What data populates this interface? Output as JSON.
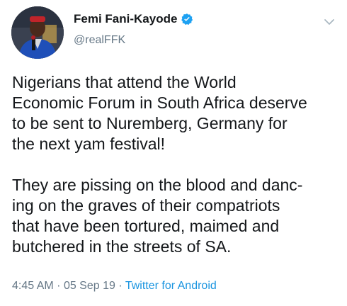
{
  "tweet": {
    "author": {
      "display_name": "Femi Fani-Kayode",
      "handle": "@realFFK",
      "verified_icon": "verified-badge-icon",
      "avatar": "avatar-photo"
    },
    "menu_icon": "chevron-down-icon",
    "paragraphs": [
      "Nigerians that attend the World\nEconomic Forum in South Africa deserve\nto be sent to Nuremberg, Germany for\nthe next yam festival!",
      "They are pissing on the blood and danc-\ning on the graves of their compatriots\nthat have been tortured, maimed and\nbutchered in the streets of SA."
    ],
    "meta": {
      "time": "4:45 AM",
      "separator": "·",
      "date": "05 Sep 19",
      "source": "Twitter for Android"
    }
  },
  "colors": {
    "text": "#14171a",
    "secondary": "#657786",
    "link": "#1b95e0",
    "verified": "#1da1f2"
  }
}
